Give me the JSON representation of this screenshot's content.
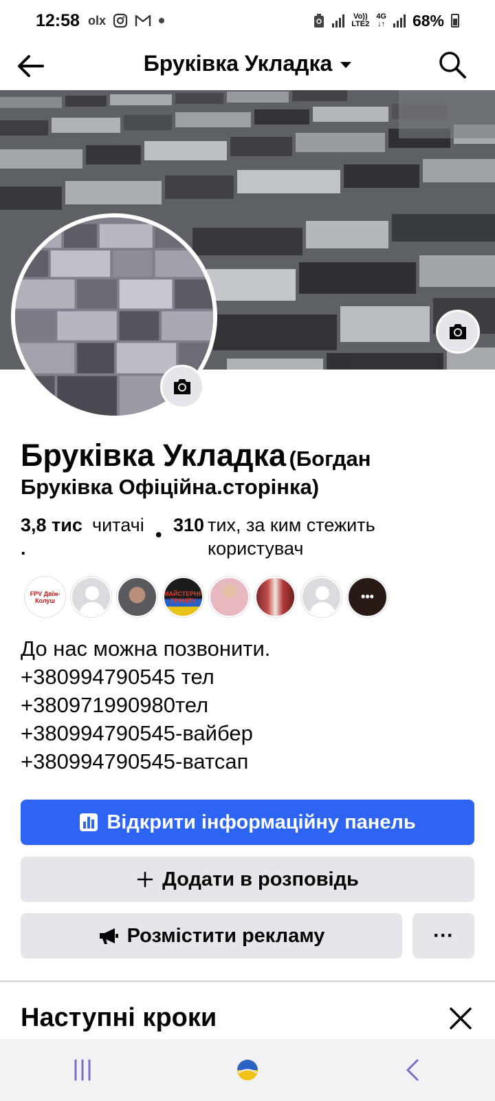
{
  "status_bar": {
    "time": "12:58",
    "left_icons": [
      "olx-icon",
      "instagram-icon",
      "gmail-icon",
      "dot-icon"
    ],
    "olx_text": "olx",
    "volte_label_top": "Vo))",
    "volte_label_bottom": "LTE2",
    "network_type": "4G",
    "battery_percent": "68%"
  },
  "header": {
    "title": "Бруківка Укладка"
  },
  "profile": {
    "name": "Бруківка Укладка",
    "alternate_name_part1": "(Богдан",
    "alternate_name_part2": "Бруківка Офіційна.сторінка)",
    "followers_count": "3,8 тис",
    "followers_label": "читачі",
    "followers_dot": ".",
    "separator": "•",
    "following_count": "310",
    "following_label": "тих, за ким стежить користувач"
  },
  "followers_preview": [
    {
      "label": "FPV Двіж-Колуш",
      "kind": "logo",
      "color": "#ffffff"
    },
    {
      "label": "",
      "kind": "default"
    },
    {
      "label": "",
      "kind": "photo",
      "color": "#6a6a6e"
    },
    {
      "label": "МАЙСТЕРНЯ ГРАНІТУ",
      "kind": "logo",
      "color": "#1c1c1c"
    },
    {
      "label": "",
      "kind": "photo",
      "color": "#e8b8c0"
    },
    {
      "label": "",
      "kind": "photo",
      "color": "#b43a3a"
    },
    {
      "label": "",
      "kind": "default"
    },
    {
      "label": "•••",
      "kind": "more",
      "color": "#2a1a16"
    }
  ],
  "bio": {
    "lines": [
      "До нас можна позвонити.",
      "+380994790545 тел",
      "+380971990980тел",
      "+380994790545-вайбер",
      "+380994790545-ватсап"
    ]
  },
  "actions": {
    "dashboard_label": "Відкрити інформаційну панель",
    "story_label": "Додати в розповідь",
    "ad_label": "Розмістити рекламу",
    "more_label": "···"
  },
  "next_steps": {
    "title": "Наступні кроки"
  },
  "colors": {
    "primary_blue": "#2d64f4",
    "button_gray": "#e4e6eb",
    "text": "#050505"
  }
}
